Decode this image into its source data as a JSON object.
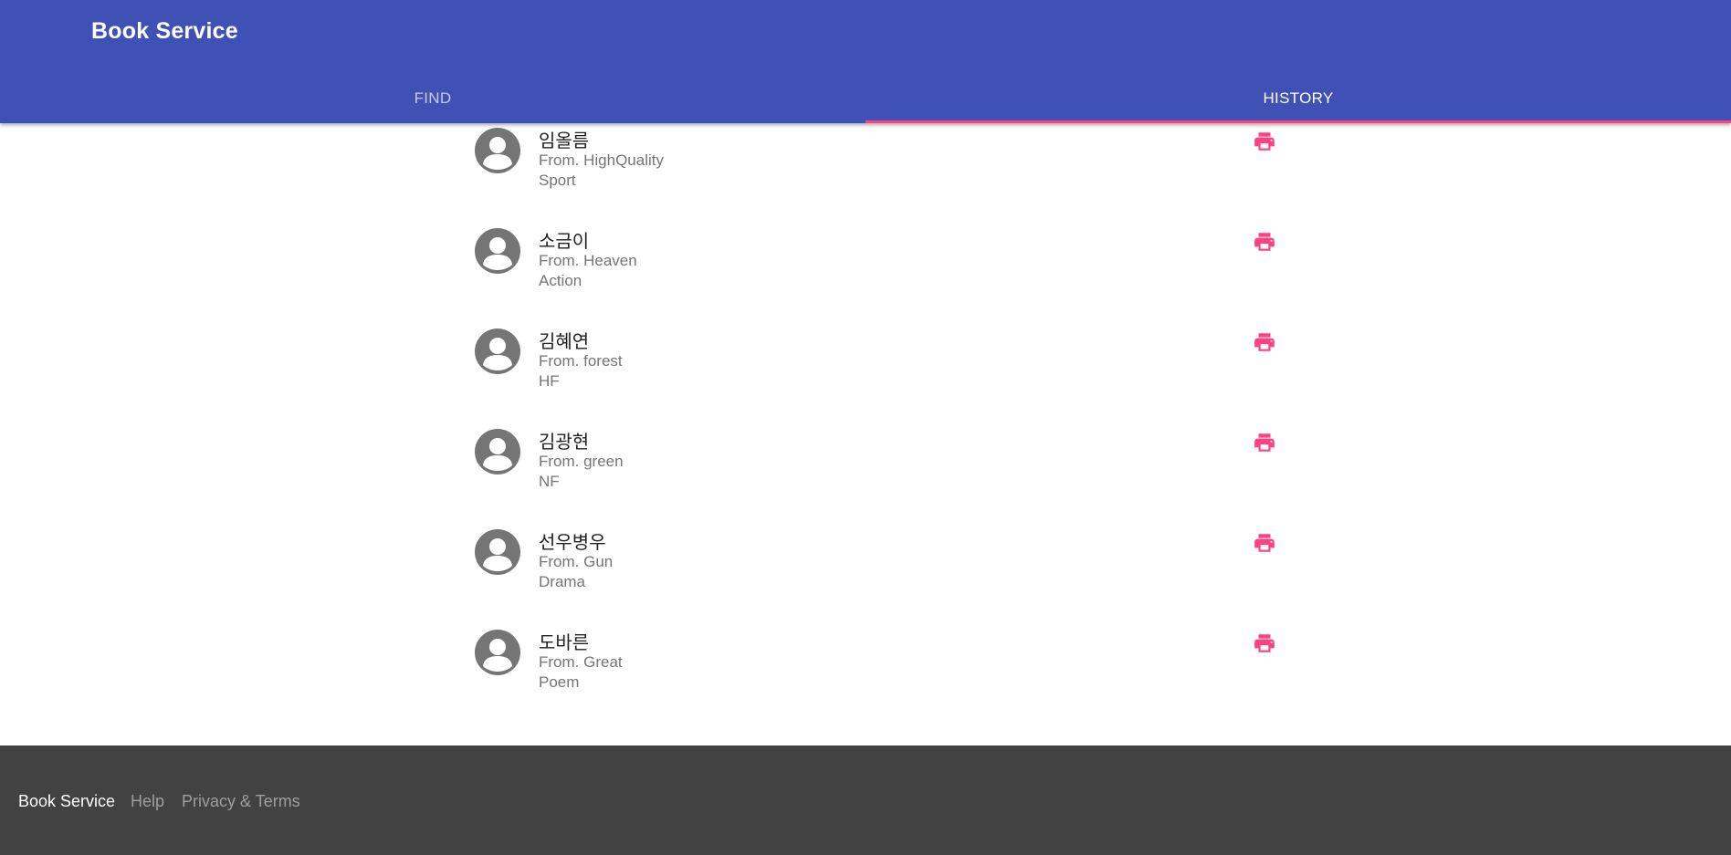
{
  "header": {
    "title": "Book Service",
    "tabs": [
      {
        "label": "FIND",
        "active": false
      },
      {
        "label": "HISTORY",
        "active": true
      }
    ]
  },
  "history": [
    {
      "name": "임올름",
      "from": "From. HighQuality",
      "genre": "Sport",
      "action_icon": "print-icon"
    },
    {
      "name": "소금이",
      "from": "From. Heaven",
      "genre": "Action",
      "action_icon": "print-icon"
    },
    {
      "name": "김혜연",
      "from": "From. forest",
      "genre": "HF",
      "action_icon": "print-icon"
    },
    {
      "name": "김광현",
      "from": "From. green",
      "genre": "NF",
      "action_icon": "print-icon"
    },
    {
      "name": "선우병우",
      "from": "From. Gun",
      "genre": "Drama",
      "action_icon": "print-icon"
    },
    {
      "name": "도바른",
      "from": "From. Great",
      "genre": "Poem",
      "action_icon": "print-icon"
    }
  ],
  "footer": {
    "logo": "Book Service",
    "links": [
      "Help",
      "Privacy & Terms"
    ]
  },
  "colors": {
    "primary": "#3f51b5",
    "accent": "#ff4081",
    "footer_bg": "#424242",
    "avatar_bg": "#757575"
  }
}
